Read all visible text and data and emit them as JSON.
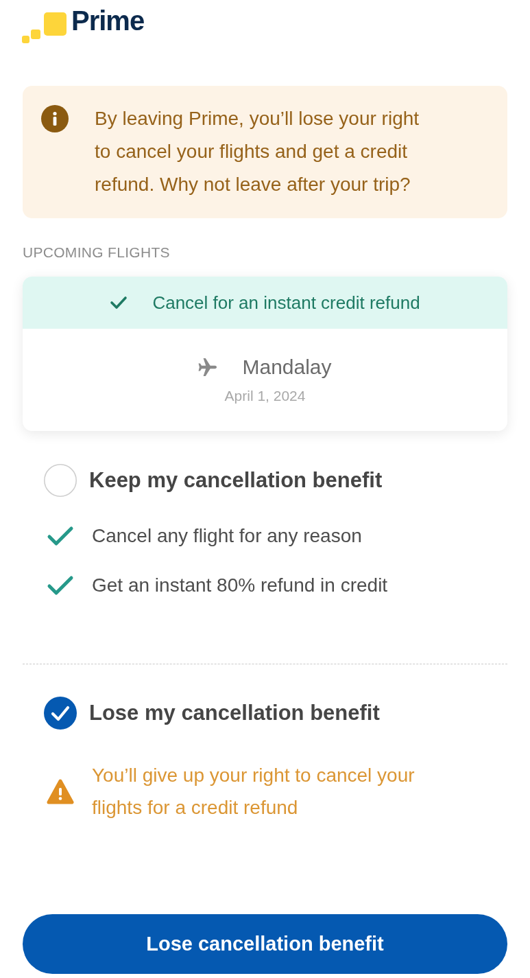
{
  "logo": {
    "text": "Prime"
  },
  "notice": {
    "text": "By leaving Prime, you’ll lose your right to cancel your flights and get a credit refund. Why not leave after your trip?"
  },
  "upcoming_flights": {
    "heading": "UPCOMING FLIGHTS",
    "flights": [
      {
        "banner": "Cancel for an instant credit refund",
        "destination": "Mandalay",
        "date": "April 1, 2024"
      }
    ]
  },
  "options": [
    {
      "title": "Keep my cancellation benefit",
      "selected": false,
      "points": [
        {
          "kind": "benefit",
          "text": "Cancel any flight for any reason"
        },
        {
          "kind": "benefit",
          "text": "Get an instant 80% refund in credit"
        }
      ]
    },
    {
      "title": "Lose my cancellation benefit",
      "selected": true,
      "points": [
        {
          "kind": "warning",
          "text": "You’ll give up your right to cancel your flights for a credit refund"
        }
      ]
    }
  ],
  "button": {
    "label": "Lose cancellation benefit"
  }
}
